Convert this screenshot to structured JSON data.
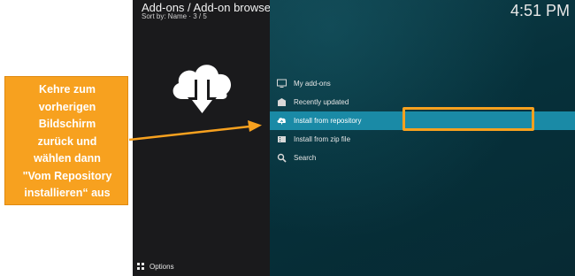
{
  "header": {
    "title": "Add-ons / Add-on browser",
    "sort_info": "Sort by: Name  ·  3 / 5",
    "clock": "4:51 PM"
  },
  "hero_icon": "cloud-download-icon",
  "menu": {
    "items": [
      {
        "label": "My add-ons",
        "icon": "monitor-icon",
        "focused": false
      },
      {
        "label": "Recently updated",
        "icon": "box-icon",
        "focused": false
      },
      {
        "label": "Install from repository",
        "icon": "cloud-upload-icon",
        "focused": true
      },
      {
        "label": "Install from zip file",
        "icon": "zip-icon",
        "focused": false
      },
      {
        "label": "Search",
        "icon": "search-icon",
        "focused": false
      }
    ]
  },
  "footer": {
    "options_label": "Options",
    "options_icon": "options-icon"
  },
  "annotation": {
    "lines": [
      "Kehre zum",
      "vorherigen",
      "Bildschirm",
      "zurück und",
      "wählen dann",
      "\"Vom Repository",
      "installieren“ aus"
    ],
    "color": "#f7a11f"
  },
  "colors": {
    "focus": "#1a8aa6",
    "left_pane": "#1a1a1c",
    "right_pane": "#06303a",
    "accent": "#f7a11f"
  }
}
